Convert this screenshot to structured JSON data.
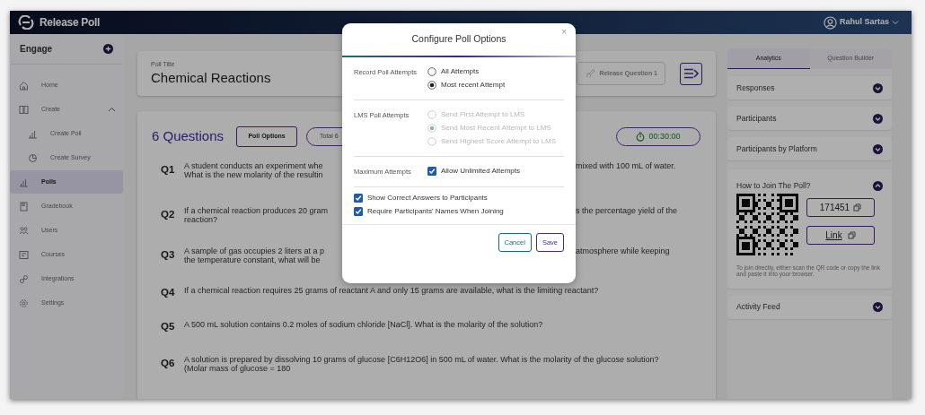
{
  "app": {
    "name": "Release Poll"
  },
  "user": {
    "name": "Rahul Sartas"
  },
  "sidebar": {
    "title": "Engage",
    "items": [
      {
        "label": "Home",
        "selected": false
      },
      {
        "label": "Create",
        "selected": false,
        "expanded": true,
        "children": [
          {
            "label": "Create Poll",
            "selected": false
          },
          {
            "label": "Create Survey",
            "selected": false
          }
        ]
      },
      {
        "label": "Polls",
        "selected": true
      },
      {
        "label": "Gradebook",
        "selected": false
      },
      {
        "label": "Users",
        "selected": false
      },
      {
        "label": "Courses",
        "selected": false
      },
      {
        "label": "Integrations",
        "selected": false
      },
      {
        "label": "Settings",
        "selected": false
      }
    ]
  },
  "poll": {
    "title_label": "Poll Title",
    "title": "Chemical Reactions",
    "release_button": {
      "label": "Release Question 1",
      "disabled": true
    }
  },
  "questions_header": {
    "count": "6 Questions",
    "options_button": "Poll Options",
    "total_button": "Total 6",
    "timer": "00:30:00"
  },
  "questions": [
    {
      "number": "Q1",
      "left": [
        "A student conducts an experiment whe",
        "What is the new molarity of the resultin"
      ],
      "right": [
        "mixed with 100 mL of water."
      ]
    },
    {
      "number": "Q2",
      "left": [
        "If a chemical reaction produces 20 gram",
        "reaction?"
      ],
      "right": [
        "s the percentage yield of the"
      ]
    },
    {
      "number": "Q3",
      "left": [
        "A sample of gas occupies 2 liters at a p",
        "the temperature constant, what will be"
      ],
      "right": [
        "atmosphere while keeping"
      ]
    },
    {
      "number": "Q4",
      "text": "If a chemical reaction requires 25 grams of reactant A and only 15 grams are available, what is the limiting reactant?"
    },
    {
      "number": "Q5",
      "text": "A 500 mL solution contains 0.2 moles of sodium chloride [NaCl]. What is the molarity of the solution?"
    },
    {
      "number": "Q6",
      "text": "A solution is prepared by dissolving 10 grams of glucose [C6H12O6] in 500 mL of water. What is the molarity of the glucose solution? (Molar mass of glucose = 180"
    }
  ],
  "right_panel": {
    "tabs": [
      {
        "label": "Analytics",
        "selected": true
      },
      {
        "label": "Question Builder",
        "selected": false
      }
    ],
    "sections": [
      {
        "title": "Responses",
        "expanded": false
      },
      {
        "title": "Participants",
        "expanded": false
      },
      {
        "title": "Participants by Platform",
        "expanded": false
      },
      {
        "title": "How to Join The Poll?",
        "expanded": true,
        "code": "171451",
        "link": "Link",
        "help": "To join directly, either scan the QR code or copy the link and paste it into your browser."
      },
      {
        "title": "Activity Feed",
        "expanded": false
      }
    ]
  },
  "modal": {
    "title": "Configure Poll Options",
    "close": "×",
    "sections": [
      {
        "kind": "radio",
        "label": "Record Poll Attempts",
        "disabled": false,
        "options": [
          {
            "label": "All Attempts",
            "selected": false
          },
          {
            "label": "Most recent Attempt",
            "selected": true
          }
        ]
      },
      {
        "kind": "radio",
        "label": "LMS Poll Attempts",
        "disabled": true,
        "options": [
          {
            "label": "Send First Attempt to LMS",
            "selected": false
          },
          {
            "label": "Send Most Recent Attempt to LMS",
            "selected": true
          },
          {
            "label": "Send Highest Score Attempt to LMS",
            "selected": false
          }
        ]
      },
      {
        "kind": "checkbox",
        "label": "Maximum Attempts",
        "disabled": false,
        "options": [
          {
            "label": "Allow Unlimited Attempts",
            "checked": true
          }
        ]
      }
    ],
    "checks": [
      {
        "label": "Show Correct Answers to Participants",
        "checked": true
      },
      {
        "label": "Require Participants' Names When Joining",
        "checked": true
      }
    ],
    "buttons": [
      {
        "label": "Cancel",
        "kind": "secondary"
      },
      {
        "label": "Save",
        "kind": "primary"
      }
    ]
  }
}
